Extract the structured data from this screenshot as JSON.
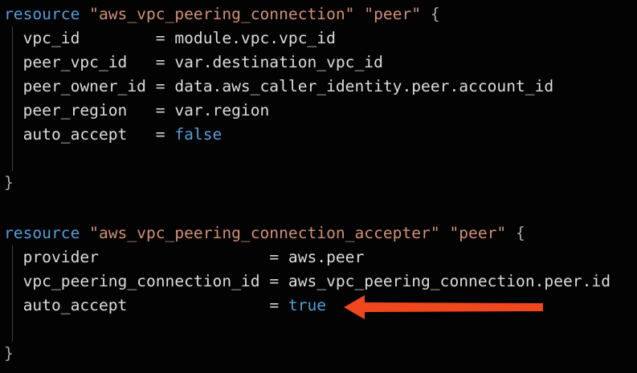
{
  "colors": {
    "background": "#030303",
    "keyword": "#569cd6",
    "string": "#ce9178",
    "text": "#d4d4d4",
    "brace": "#a8a8a8",
    "arrow": "#f0471f"
  },
  "blocks": [
    {
      "keyword": "resource",
      "type": "\"aws_vpc_peering_connection\"",
      "name": "\"peer\"",
      "open": "{",
      "lines": [
        {
          "key": "vpc_id        ",
          "eq": "=",
          "value": "module.vpc.vpc_id",
          "value_kind": "id"
        },
        {
          "key": "peer_vpc_id   ",
          "eq": "=",
          "value": "var.destination_vpc_id",
          "value_kind": "id"
        },
        {
          "key": "peer_owner_id ",
          "eq": "=",
          "value": "data.aws_caller_identity.peer.account_id",
          "value_kind": "id"
        },
        {
          "key": "peer_region   ",
          "eq": "=",
          "value": "var.region",
          "value_kind": "id"
        },
        {
          "key": "auto_accept   ",
          "eq": "=",
          "value": "false",
          "value_kind": "bool"
        }
      ],
      "close": "}"
    },
    {
      "keyword": "resource",
      "type": "\"aws_vpc_peering_connection_accepter\"",
      "name": "\"peer\"",
      "open": "{",
      "lines": [
        {
          "key": "provider                  ",
          "eq": "=",
          "value": "aws.peer",
          "value_kind": "id"
        },
        {
          "key": "vpc_peering_connection_id ",
          "eq": "=",
          "value": "aws_vpc_peering_connection.peer.id",
          "value_kind": "id"
        },
        {
          "key": "auto_accept               ",
          "eq": "=",
          "value": "true",
          "value_kind": "bool"
        }
      ],
      "close": "}"
    }
  ],
  "annotation": {
    "icon": "left-arrow-icon",
    "points_to": "true"
  }
}
